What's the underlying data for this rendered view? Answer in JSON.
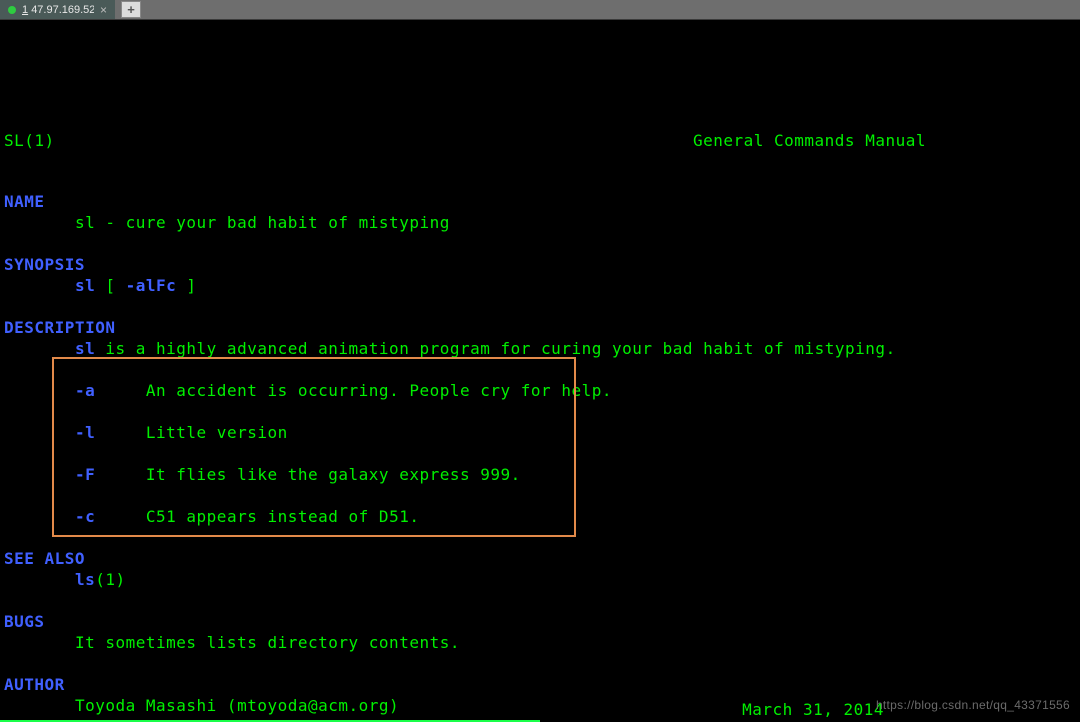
{
  "tabbar": {
    "tab1": {
      "index": "1",
      "title": "47.97.169.52",
      "close_glyph": "×"
    },
    "newtab_glyph": "+"
  },
  "man": {
    "header_left": "SL(1)",
    "header_right": "General Commands Manual",
    "sections": {
      "name": "NAME",
      "synopsis": "SYNOPSIS",
      "description": "DESCRIPTION",
      "see_also": "SEE ALSO",
      "bugs": "BUGS",
      "author": "AUTHOR"
    },
    "name_line": "sl - cure your bad habit of mistyping",
    "synopsis_cmd": "sl",
    "synopsis_open": " [ ",
    "synopsis_flags": "-alFc",
    "synopsis_close": " ]",
    "desc_cmd": "sl",
    "desc_rest": " is a highly advanced animation program for curing your bad habit of mistyping.",
    "options": [
      {
        "flag": "-a",
        "text": "An accident is occurring. People cry for help."
      },
      {
        "flag": "-l",
        "text": "Little version"
      },
      {
        "flag": "-F",
        "text": "It flies like the galaxy express 999."
      },
      {
        "flag": "-c",
        "text": "C51 appears instead of D51."
      }
    ],
    "seealso_cmd": "ls",
    "seealso_suffix": "(1)",
    "bugs_line": "It sometimes lists directory contents.",
    "author_line": "Toyoda Masashi (mtoyoda@acm.org)",
    "footer_date": "March 31, 2014"
  },
  "watermark": "https://blog.csdn.net/qq_43371556"
}
